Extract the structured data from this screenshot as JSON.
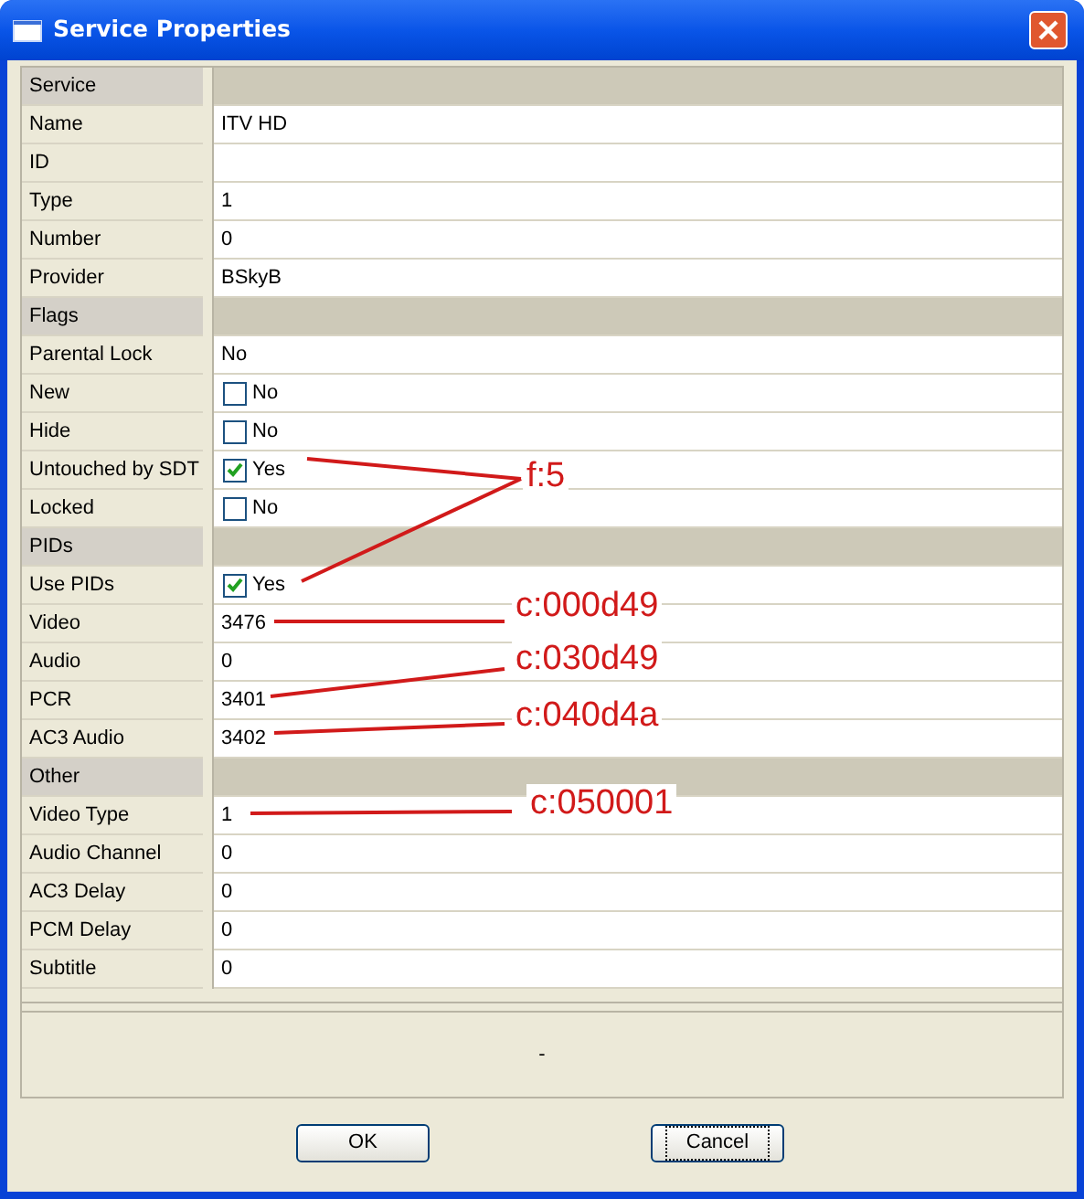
{
  "window": {
    "title": "Service Properties"
  },
  "rows": [
    {
      "kind": "header",
      "label": "Service"
    },
    {
      "kind": "text",
      "label": "Name",
      "value": "ITV HD"
    },
    {
      "kind": "text",
      "label": "ID"
    },
    {
      "kind": "text",
      "label": "Type",
      "value": "1"
    },
    {
      "kind": "text",
      "label": "Number",
      "value": "0"
    },
    {
      "kind": "text",
      "label": "Provider",
      "value": "BSkyB"
    },
    {
      "kind": "header",
      "label": "Flags"
    },
    {
      "kind": "text",
      "label": "Parental Lock",
      "value": "No"
    },
    {
      "kind": "checkbox",
      "label": "New",
      "checked": false,
      "value": "No"
    },
    {
      "kind": "checkbox",
      "label": "Hide",
      "checked": false,
      "value": "No"
    },
    {
      "kind": "checkbox",
      "label": "Untouched by SDT",
      "checked": true,
      "value": "Yes"
    },
    {
      "kind": "checkbox",
      "label": "Locked",
      "checked": false,
      "value": "No"
    },
    {
      "kind": "header",
      "label": "PIDs"
    },
    {
      "kind": "checkbox",
      "label": "Use PIDs",
      "checked": true,
      "value": "Yes"
    },
    {
      "kind": "text",
      "label": "Video",
      "value": "3476"
    },
    {
      "kind": "text",
      "label": "Audio",
      "value": "0"
    },
    {
      "kind": "text",
      "label": "PCR",
      "value": "3401"
    },
    {
      "kind": "text",
      "label": "AC3 Audio",
      "value": "3402"
    },
    {
      "kind": "header",
      "label": "Other"
    },
    {
      "kind": "text",
      "label": "Video Type",
      "value": "1"
    },
    {
      "kind": "text",
      "label": "Audio Channel",
      "value": "0"
    },
    {
      "kind": "text",
      "label": "AC3 Delay",
      "value": "0"
    },
    {
      "kind": "text",
      "label": "PCM Delay",
      "value": "0"
    },
    {
      "kind": "text",
      "label": "Subtitle",
      "value": "0"
    }
  ],
  "status": "-",
  "buttons": [
    {
      "label": "OK",
      "focused": false
    },
    {
      "label": "Cancel",
      "focused": true
    }
  ],
  "annotations": [
    {
      "text": "f:5"
    },
    {
      "text": "c:000d49"
    },
    {
      "text": "c:030d49"
    },
    {
      "text": "c:040d4a"
    },
    {
      "text": "c:050001"
    }
  ]
}
